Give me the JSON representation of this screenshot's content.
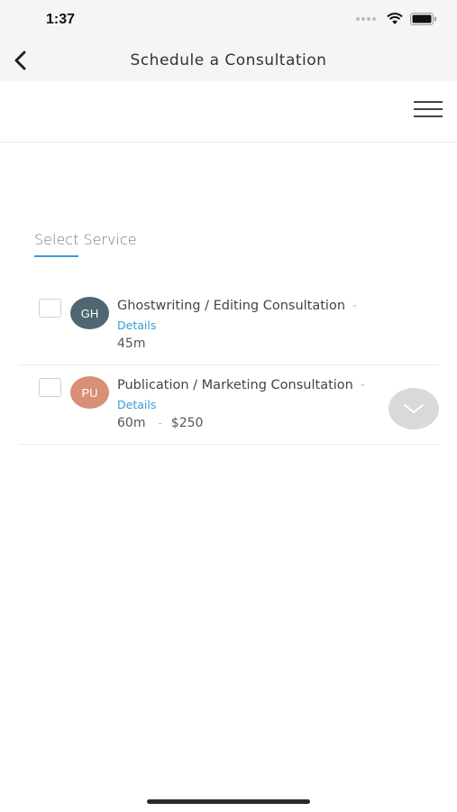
{
  "status_bar": {
    "time": "1:37"
  },
  "nav": {
    "title": "Schedule a Consultation"
  },
  "section": {
    "label": "Select Service"
  },
  "services": [
    {
      "initials": "GH",
      "avatar_color": "#4f6770",
      "name": "Ghostwriting / Editing Consultation",
      "dash": "-",
      "details_label": "Details",
      "duration": "45m",
      "price": ""
    },
    {
      "initials": "PU",
      "avatar_color": "#d78f76",
      "name": "Publication / Marketing Consultation",
      "dash": "-",
      "details_label": "Details",
      "duration": "60m",
      "separator": "-",
      "price": "$250"
    }
  ],
  "colors": {
    "accent": "#3a9ad9",
    "bar_background": "#f5f5f5"
  }
}
